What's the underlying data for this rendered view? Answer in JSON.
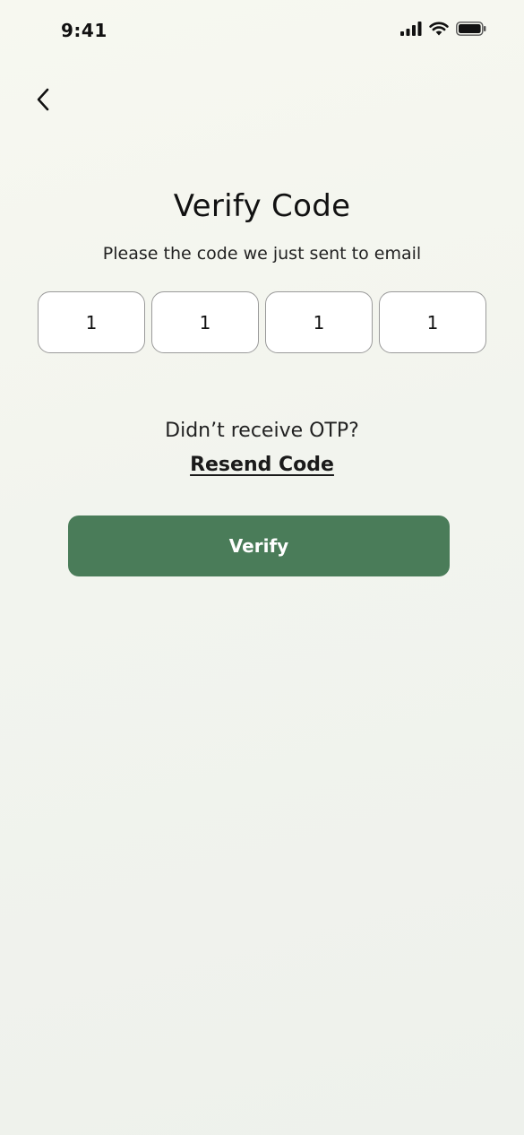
{
  "status_bar": {
    "time": "9:41",
    "icons": [
      "cellular-signal-icon",
      "wifi-icon",
      "battery-icon"
    ]
  },
  "header": {
    "back_icon": "chevron-left-icon"
  },
  "main": {
    "title": "Verify Code",
    "subtitle": "Please the code we just sent to email",
    "otp_digits": [
      "1",
      "1",
      "1",
      "1"
    ],
    "resend_prompt": "Didn’t receive OTP?",
    "resend_label": "Resend Code",
    "verify_label": "Verify"
  },
  "colors": {
    "primary": "#4a7c59",
    "background": "#f2f4ee",
    "input_border": "#9a9a9a"
  }
}
